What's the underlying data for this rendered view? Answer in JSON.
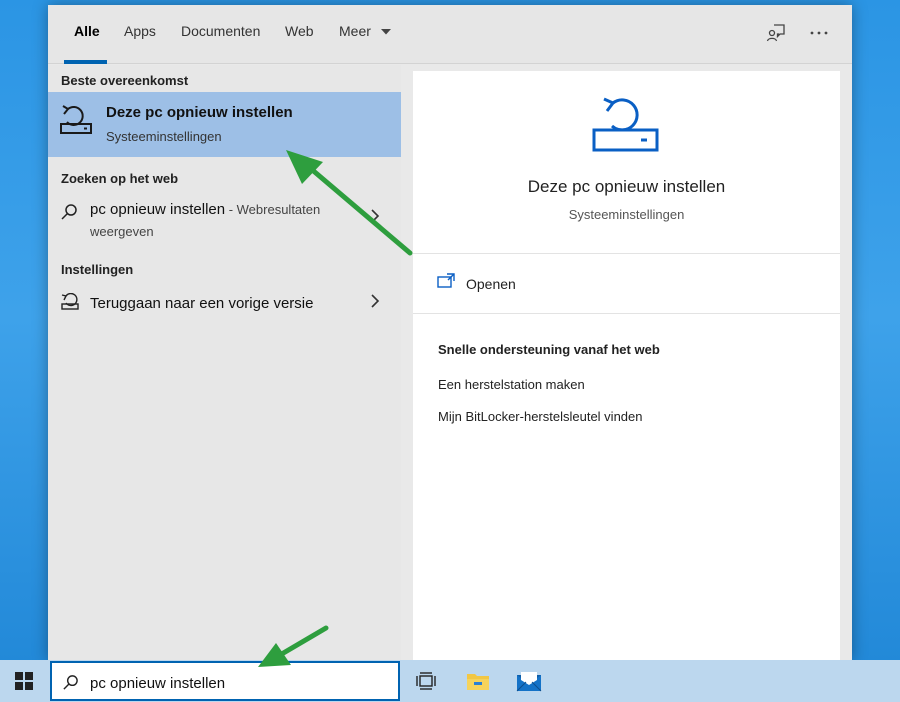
{
  "tabs": [
    {
      "label": "Alle",
      "active": true
    },
    {
      "label": "Apps"
    },
    {
      "label": "Documenten"
    },
    {
      "label": "Web"
    },
    {
      "label": "Meer"
    }
  ],
  "top_icons": [
    "feedback-icon",
    "more-options-icon"
  ],
  "left": {
    "best_match_heading": "Beste overeenkomst",
    "best_match": {
      "title": "Deze pc opnieuw instellen",
      "subtitle": "Systeeminstellingen",
      "icon": "reset-pc-icon"
    },
    "web_heading": "Zoeken op het web",
    "web_result": {
      "query": "pc opnieuw instellen",
      "suffix": " - Webresultaten",
      "line2": "weergeven",
      "icon": "search-icon"
    },
    "settings_heading": "Instellingen",
    "settings_result": {
      "label": "Teruggaan naar een vorige versie",
      "icon": "go-back-icon"
    }
  },
  "right": {
    "title": "Deze pc opnieuw instellen",
    "subtitle": "Systeeminstellingen",
    "open_label": "Openen",
    "quick_heading": "Snelle ondersteuning vanaf het web",
    "quick_links": [
      "Een herstelstation maken",
      "Mijn BitLocker-herstelsleutel vinden"
    ]
  },
  "taskbar": {
    "search_value": "pc opnieuw instellen",
    "apps": [
      "task-view-icon",
      "file-explorer-icon",
      "mail-icon"
    ]
  },
  "colors": {
    "accent": "#0063b1",
    "selected_row": "#9dbfe6",
    "annotation_arrow": "#2e9e3e",
    "desktop": "#2b95e4"
  }
}
